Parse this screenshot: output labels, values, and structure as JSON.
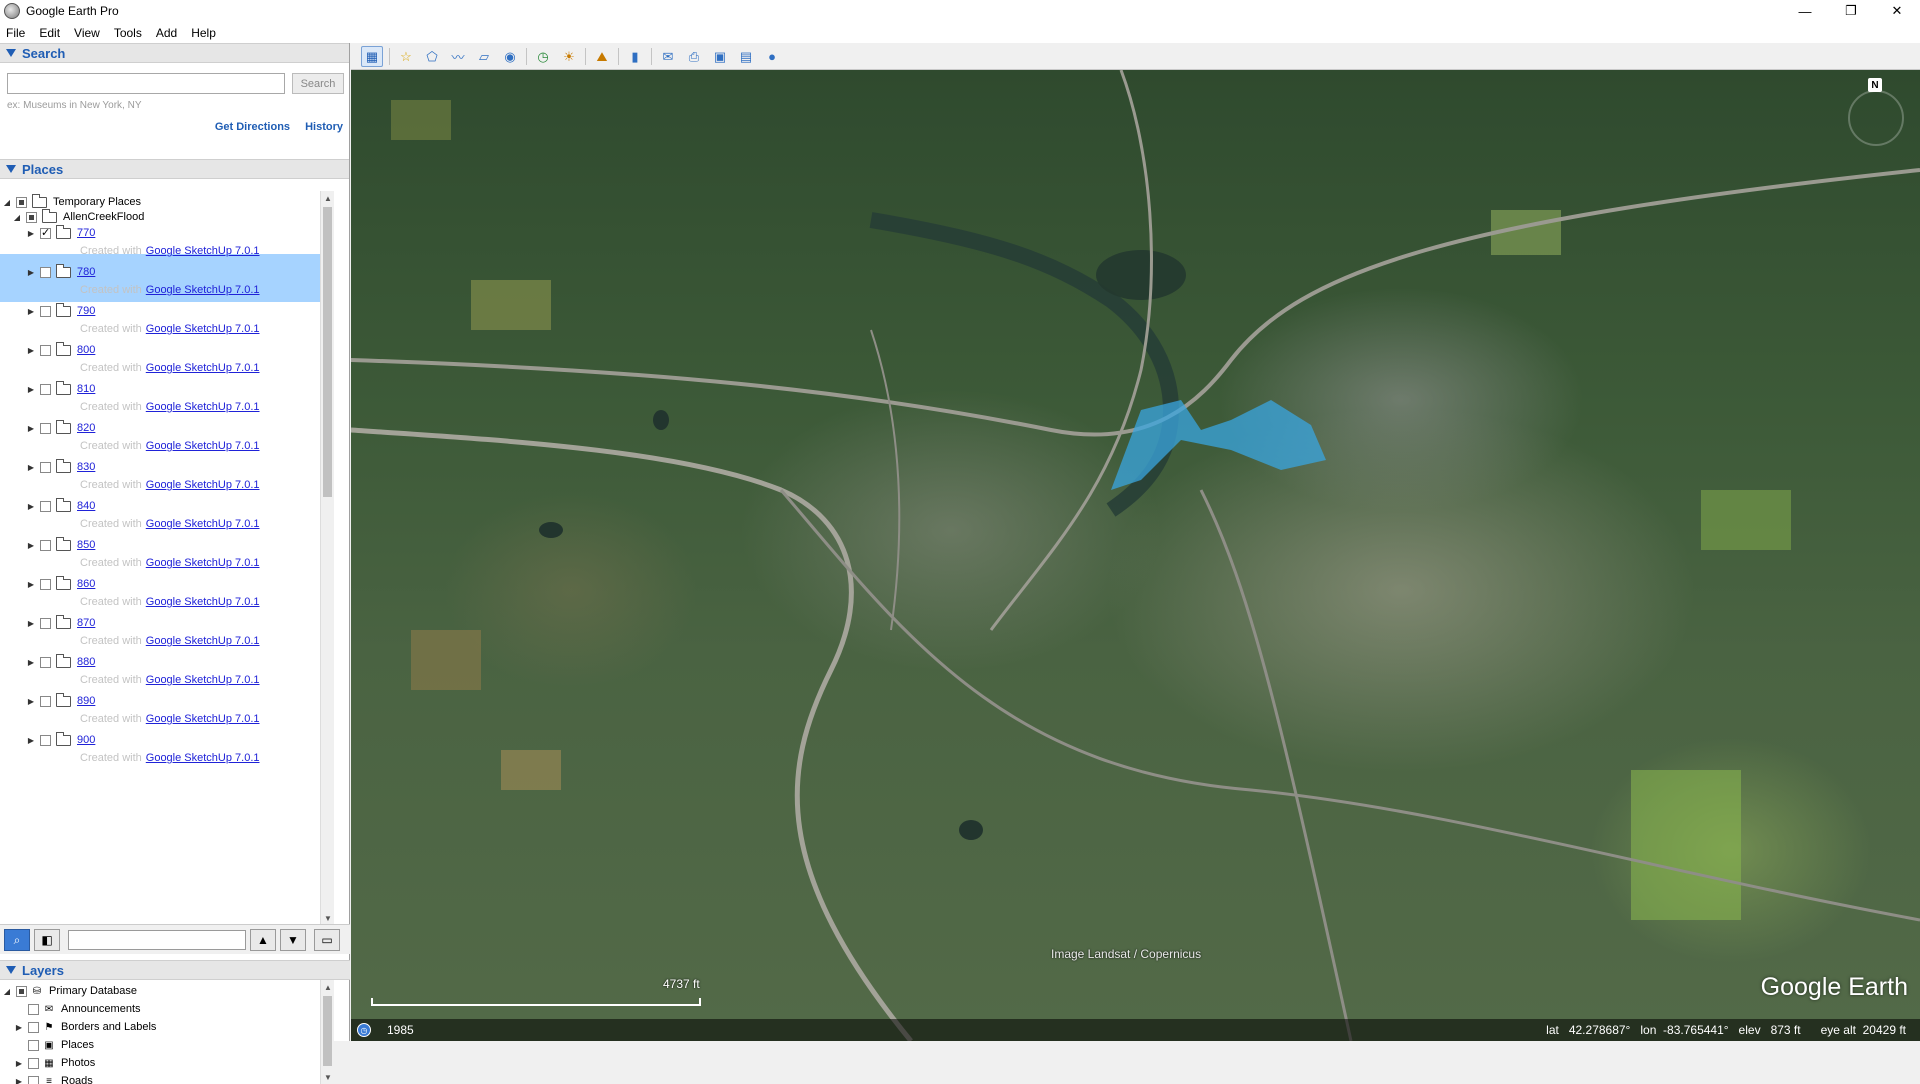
{
  "window": {
    "title": "Google Earth Pro",
    "minimize": "—",
    "maximize": "❐",
    "close": "✕"
  },
  "menu": [
    "File",
    "Edit",
    "View",
    "Tools",
    "Add",
    "Help"
  ],
  "search": {
    "header": "Search",
    "placeholder": "",
    "button": "Search",
    "hint": "ex: Museums in New York, NY",
    "get_directions": "Get Directions",
    "history": "History"
  },
  "places": {
    "header": "Places",
    "root": "Temporary Places",
    "folder": "AllenCreekFlood",
    "created_prefix": "Created with",
    "created_link": "Google SketchUp 7.0.1",
    "items": [
      {
        "label": "770",
        "checked": true
      },
      {
        "label": "780",
        "checked": false
      },
      {
        "label": "790",
        "checked": false
      },
      {
        "label": "800",
        "checked": false
      },
      {
        "label": "810",
        "checked": false
      },
      {
        "label": "820",
        "checked": false
      },
      {
        "label": "830",
        "checked": false
      },
      {
        "label": "840",
        "checked": false
      },
      {
        "label": "850",
        "checked": false
      },
      {
        "label": "860",
        "checked": false
      },
      {
        "label": "870",
        "checked": false
      },
      {
        "label": "880",
        "checked": false
      },
      {
        "label": "890",
        "checked": false
      },
      {
        "label": "900",
        "checked": false
      }
    ]
  },
  "layers": {
    "header": "Layers",
    "items": [
      {
        "label": "Primary Database",
        "icon": "database-icon"
      },
      {
        "label": "Announcements",
        "icon": "envelope-icon"
      },
      {
        "label": "Borders and Labels",
        "icon": "flag-icon"
      },
      {
        "label": "Places",
        "icon": "places-icon"
      },
      {
        "label": "Photos",
        "icon": "photo-icon"
      },
      {
        "label": "Roads",
        "icon": "road-icon"
      }
    ]
  },
  "map": {
    "attribution": "Image Landsat / Copernicus",
    "scale": "4737 ft",
    "brand": "Google Earth",
    "year": "1985",
    "compass_label": "N",
    "status": "lat   42.278687°   lon  -83.765441°   elev   873 ft      eye alt  20429 ft"
  },
  "colors": {
    "accent": "#1f5db4",
    "selection": "#a6d3ff",
    "flood_overlay": "#3aa6e0",
    "link": "#1f22d8"
  }
}
